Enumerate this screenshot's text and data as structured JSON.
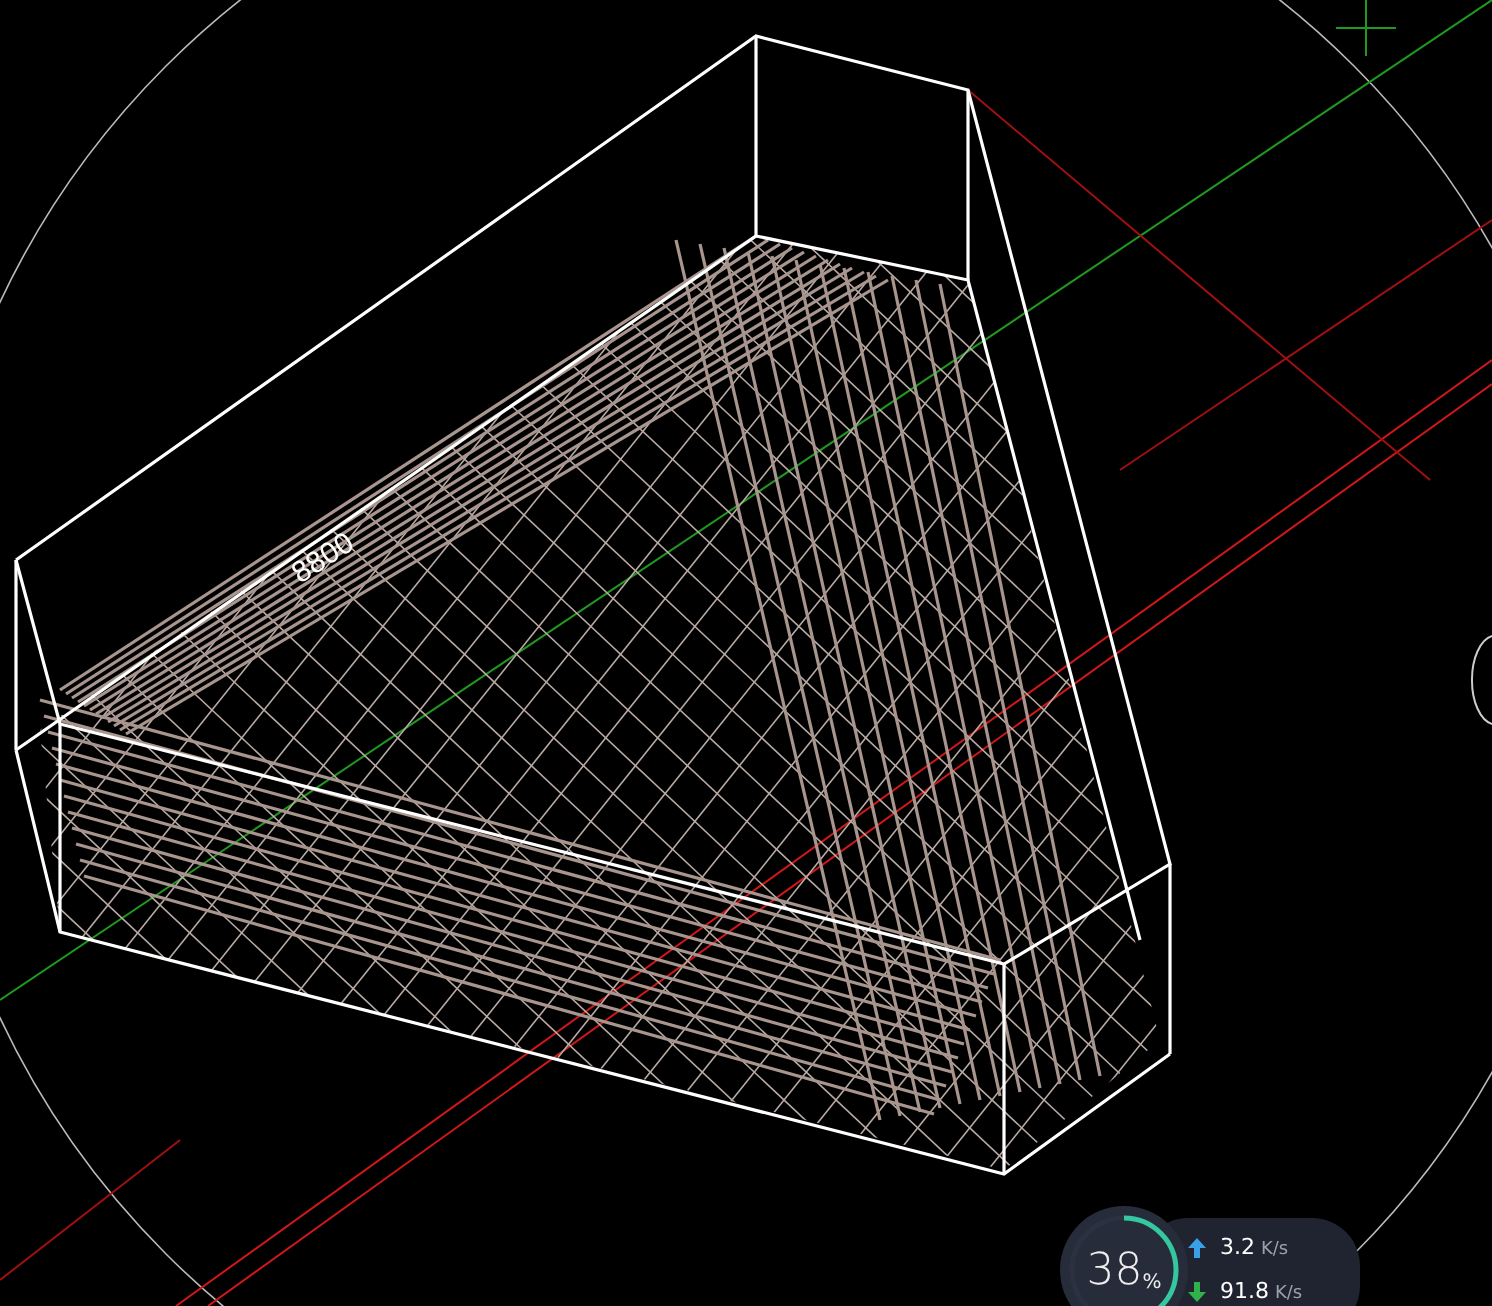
{
  "viewport": {
    "dimension_label": "8800"
  },
  "network_widget": {
    "percent": "38",
    "percent_unit": "%",
    "level": 0.38,
    "rates": [
      {
        "kind": "upload",
        "value": "3.2",
        "unit": "K/s"
      },
      {
        "kind": "download",
        "value": "91.8",
        "unit": "K/s"
      }
    ]
  }
}
